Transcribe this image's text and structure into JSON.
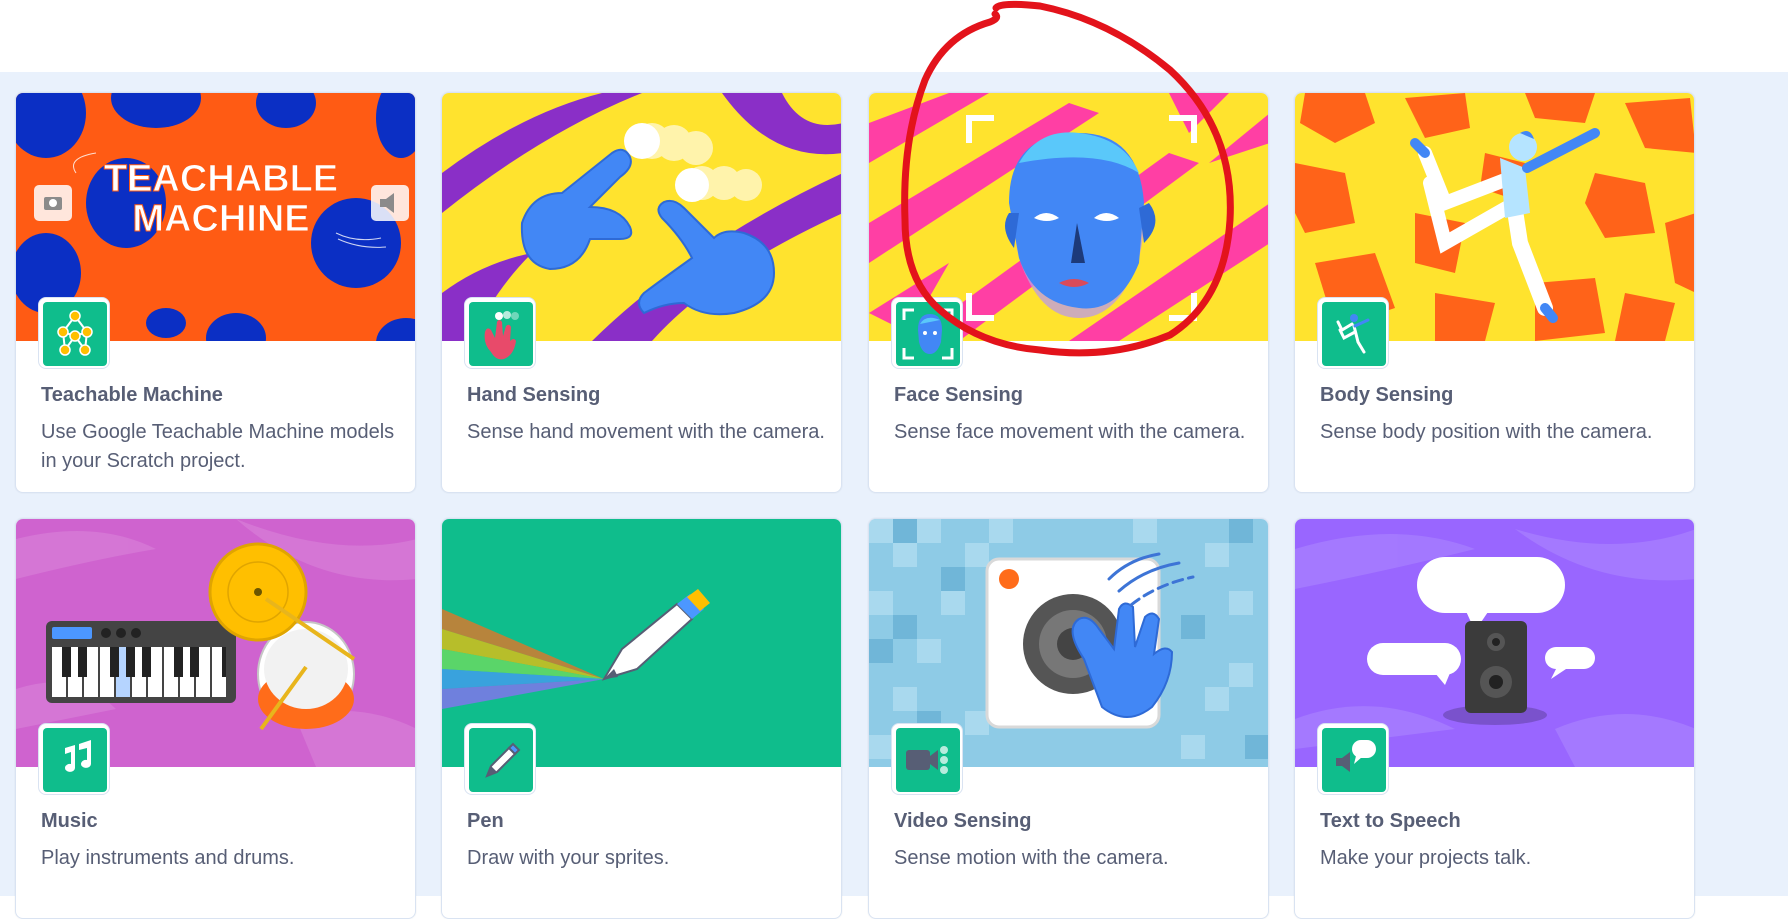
{
  "extensions": [
    {
      "title": "Teachable Machine",
      "description": "Use Google Teachable Machine models in your Scratch project.",
      "banner_text": "TEACHABLE MACHINE",
      "icon": "network-nodes-icon"
    },
    {
      "title": "Hand Sensing",
      "description": "Sense hand movement with the camera.",
      "icon": "hand-icon"
    },
    {
      "title": "Face Sensing",
      "description": "Sense face movement with the camera.",
      "icon": "face-icon"
    },
    {
      "title": "Body Sensing",
      "description": "Sense body position with the camera.",
      "icon": "body-pose-icon"
    },
    {
      "title": "Music",
      "description": "Play instruments and drums.",
      "icon": "music-notes-icon"
    },
    {
      "title": "Pen",
      "description": "Draw with your sprites.",
      "icon": "pen-icon"
    },
    {
      "title": "Video Sensing",
      "description": "Sense motion with the camera.",
      "icon": "video-camera-icon"
    },
    {
      "title": "Text to Speech",
      "description": "Make your projects talk.",
      "icon": "speech-bubble-icon"
    }
  ],
  "colors": {
    "accent": "#0fbd8c",
    "gallery_bg": "#e9f1fc",
    "text": "#575e75",
    "annotation": "#e3131b"
  }
}
